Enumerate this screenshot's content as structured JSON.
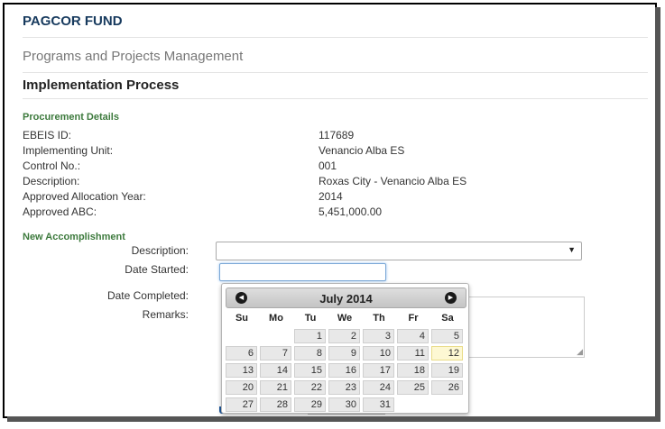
{
  "header": {
    "brand": "PAGCOR FUND",
    "module": "Programs and Projects Management",
    "section": "Implementation Process"
  },
  "procurement": {
    "title": "Procurement Details",
    "rows": [
      {
        "label": "EBEIS ID:",
        "value": "117689"
      },
      {
        "label": "Implementing Unit:",
        "value": "Venancio Alba ES"
      },
      {
        "label": "Control No.:",
        "value": "001"
      },
      {
        "label": "Description:",
        "value": "Roxas City - Venancio Alba ES"
      },
      {
        "label": "Approved Allocation Year:",
        "value": "2014"
      },
      {
        "label": "Approved ABC:",
        "value": "5,451,000.00"
      }
    ]
  },
  "accomplishment": {
    "title": "New Accomplishment",
    "description_label": "Description:",
    "date_started_label": "Date Started:",
    "date_completed_label": "Date Completed:",
    "remarks_label": "Remarks:",
    "dropdown_arrow": "▼"
  },
  "datepicker": {
    "title": "July 2014",
    "prev_icon": "◀",
    "next_icon": "▶",
    "weekdays": [
      "Su",
      "Mo",
      "Tu",
      "We",
      "Th",
      "Fr",
      "Sa"
    ],
    "first_weekday_index": 2,
    "days_in_month": 31,
    "today": 12
  },
  "colors": {
    "brand": "#173a5e",
    "subsection": "#3d7a3d",
    "primary_button": "#1f5aa0"
  }
}
